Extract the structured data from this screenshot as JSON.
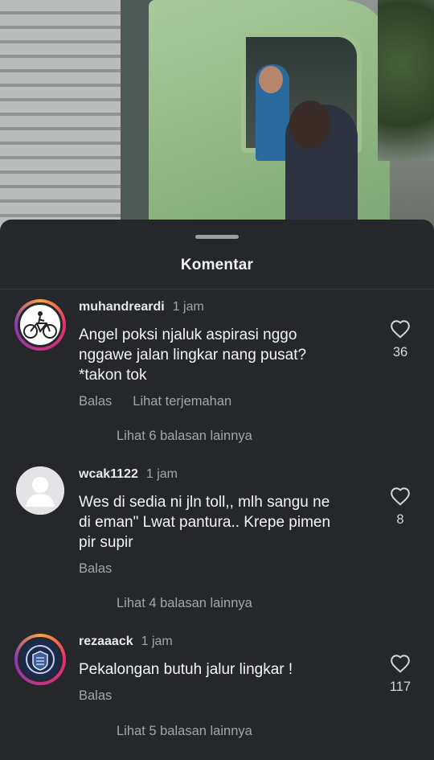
{
  "sheet": {
    "title": "Komentar"
  },
  "comments": [
    {
      "username": "muhandreardi",
      "time": "1 jam",
      "text": "Angel poksi njaluk aspirasi nggo\nnggawe jalan lingkar nang pusat?\n*takon tok",
      "reply_label": "Balas",
      "translate_label": "Lihat terjemahan",
      "likes": "36",
      "more_replies": "Lihat 6 balasan lainnya"
    },
    {
      "username": "wcak1122",
      "time": "1 jam",
      "text": "Wes di sedia ni jln toll,, mlh sangu ne\ndi eman\" Lwat pantura.. Krepe pimen\npir supir",
      "reply_label": "Balas",
      "likes": "8",
      "more_replies": "Lihat 4 balasan lainnya"
    },
    {
      "username": "rezaaack",
      "time": "1 jam",
      "text": "Pekalongan butuh jalur lingkar !",
      "reply_label": "Balas",
      "likes": "117",
      "more_replies": "Lihat 5 balasan lainnya"
    }
  ],
  "icons": {
    "like": "heart-outline-icon",
    "default_avatar": "person-silhouette-icon"
  },
  "colors": {
    "sheet_bg": "#25272b",
    "text_primary": "#f3f4f6",
    "text_secondary": "#a2a5ab"
  }
}
